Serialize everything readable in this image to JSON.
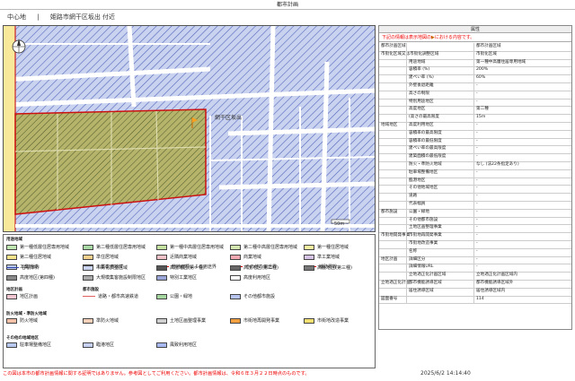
{
  "title": "都市計画",
  "location": {
    "area": "中心地",
    "separator": "|",
    "address": "姫路市網干区坂出 付近"
  },
  "map": {
    "label_area": "網干区坂出",
    "scale_label": "50m"
  },
  "legend": {
    "zoning_title": "用途地域",
    "zoning": [
      {
        "label": "第一種低層住居専用地域",
        "color": "#bfe6b0"
      },
      {
        "label": "第二種低層住居専用地域",
        "color": "#a8d8a4"
      },
      {
        "label": "第一種中高層住居専用地域",
        "color": "#c4e3a0"
      },
      {
        "label": "第二種中高層住居専用地域",
        "color": "#d3e6b0"
      },
      {
        "label": "第一種住居地域",
        "color": "#f7efa0"
      },
      {
        "label": "第二種住居地域",
        "color": "#f5e38a"
      },
      {
        "label": "準住居地域",
        "color": "#f5cf8c"
      },
      {
        "label": "近隣商業地域",
        "color": "#f3c1c8"
      },
      {
        "label": "商業地域",
        "color": "#f1a8b0"
      },
      {
        "label": "準工業地域",
        "color": "#d7c3e6"
      },
      {
        "label": "工業地域",
        "color": "#b8c8ee"
      },
      {
        "label": "工業専用地域",
        "color": "#a6b8e8"
      },
      {
        "label": "敷地面積による用途界",
        "color": "#cc0000"
      },
      {
        "label": "その他の用途界",
        "color": "#cc0000"
      },
      {
        "label": "補助界線",
        "color": "#cc0000"
      }
    ],
    "misc": [
      {
        "label": "容積率界",
        "color": "#3344aa"
      },
      {
        "label": "市街化調整区域",
        "color": "#c9d3f0"
      },
      {
        "label": "高度地区(第一種)",
        "color": "#555555"
      },
      {
        "label": "高度地区(第二種)",
        "color": "#666666"
      },
      {
        "label": "高度地区(第三種)",
        "color": "#777777"
      },
      {
        "label": "高度地区(第四種)",
        "color": "#888888"
      },
      {
        "label": "大規模集客施設制限地区",
        "color": "#aaaaaa"
      },
      {
        "label": "特別工業地区",
        "color": "#9aa6d8"
      },
      {
        "label": "高度利用地区",
        "color": "#ffffff"
      }
    ],
    "district_title": "地区計画",
    "district": [
      {
        "label": "地区計画",
        "color": "#f3c6d2"
      }
    ],
    "facility_title": "都市施設",
    "facility": [
      {
        "label": "道路・都市高速鉄道",
        "color": "#e06060"
      },
      {
        "label": "公園・緑地",
        "color": "#a6d6a0"
      },
      {
        "label": "その他都市施設",
        "color": "#b7c4f0"
      }
    ],
    "fire_title": "防火地域・準防火地域",
    "fire": [
      {
        "label": "防火地域",
        "color": "#f4c1a8"
      },
      {
        "label": "準防火地域",
        "color": "#f6d0b8"
      },
      {
        "label": "土地区画整理事業",
        "color": "#cfcfcf"
      },
      {
        "label": "市街地再開発事業",
        "color": "#f5a040"
      },
      {
        "label": "市街地改造事業",
        "color": "#f4e070"
      }
    ],
    "other_title": "その他の地域地区",
    "other": [
      {
        "label": "駐車場整備地区",
        "color": "#b8c8ee"
      },
      {
        "label": "臨港地区",
        "color": "#c7d0f5"
      },
      {
        "label": "風致利用地区",
        "color": "#a8b8f0"
      }
    ]
  },
  "attr": {
    "title": "属性",
    "note": "下記の情報は表示地図の",
    "note2": "における内容です。",
    "rows": [
      {
        "c1": "都市計画区域",
        "c2": "",
        "c3": "都市計画区域"
      },
      {
        "c1": "市街化区域又は市街化調整区域",
        "c2": "",
        "c3": "市街化区域"
      },
      {
        "c1": "",
        "c2": "用途地域",
        "c3": "第一種中高層住居専用地域"
      },
      {
        "c1": "",
        "c2": "容積率 (%)",
        "c3": "200%"
      },
      {
        "c1": "",
        "c2": "建ぺい率 (%)",
        "c3": "60%"
      },
      {
        "c1": "",
        "c2": "外壁後退距離",
        "c3": "-"
      },
      {
        "c1": "",
        "c2": "高さの制限",
        "c3": "-"
      },
      {
        "c1": "",
        "c2": "特別用途地区",
        "c3": "-"
      },
      {
        "c1": "",
        "c2": "高度地区",
        "c3": "第二種"
      },
      {
        "c1": "",
        "c2": "(高さの最高限度",
        "c3": "15m"
      },
      {
        "c1": "",
        "c2": "高度利用地区",
        "c3": "-"
      },
      {
        "c1": "",
        "c2": "容積率の最高限度",
        "c3": "-"
      },
      {
        "c1": "",
        "c2": "容積率の最低限度",
        "c3": "-"
      },
      {
        "c1": "",
        "c2": "建ぺい率の最高限度",
        "c3": "-"
      },
      {
        "c1": "",
        "c2": "建築面積の最低限度",
        "c3": "-"
      },
      {
        "c1": "",
        "c2": "防火・準防火地域",
        "c3": "なし (法22条指定あり)"
      },
      {
        "c1": "",
        "c2": "駐車場整備地区",
        "c3": "-"
      },
      {
        "c1": "",
        "c2": "臨港地区",
        "c3": "-"
      },
      {
        "c1": "",
        "c2": "その他地域地区",
        "c3": "-"
      },
      {
        "c1": "",
        "c2": "道路",
        "c3": "-"
      },
      {
        "c1": "",
        "c2": "代表幅員",
        "c3": "-"
      },
      {
        "c1": "",
        "c2": "公園・緑地",
        "c3": "-"
      },
      {
        "c1": "",
        "c2": "その他都市施設",
        "c3": "-"
      },
      {
        "c1": "",
        "c2": "土地区画整理事業",
        "c3": "-"
      },
      {
        "c1": "",
        "c2": "市街地再開発事業",
        "c3": "-"
      },
      {
        "c1": "",
        "c2": "市街地改造事業",
        "c3": "-"
      },
      {
        "c1": "",
        "c2": "名称",
        "c3": "-"
      },
      {
        "c1": "",
        "c2": "詳細区分",
        "c3": "-"
      },
      {
        "c1": "",
        "c2": "詳細情報URL",
        "c3": "-"
      },
      {
        "c1": "",
        "c2": "立地適正化計画区域",
        "c3": "立地適正化計画区域内"
      },
      {
        "c1": "",
        "c2": "都市機能誘導区域",
        "c3": "都市機能誘導区域外"
      },
      {
        "c1": "",
        "c2": "居住誘導区域",
        "c3": "居住誘導区域内"
      },
      {
        "c1": "図面番号",
        "c2": "",
        "c3": "114"
      }
    ],
    "groups": [
      {
        "label": "地域地区",
        "row": 10
      },
      {
        "label": "都市施設",
        "row": 21
      },
      {
        "label": "市街地開発事業",
        "row": 24
      },
      {
        "label": "地区計画",
        "row": 27
      },
      {
        "label": "立地適正化計画",
        "row": 30
      }
    ]
  },
  "footer": {
    "warning": "この図は本市の都市計画情報に関する証明ではありません。参考図としてご利用ください。都市計画情報は、令和６年３月２２日時点のものです。",
    "date": "2025/6/2 14:14:40"
  }
}
